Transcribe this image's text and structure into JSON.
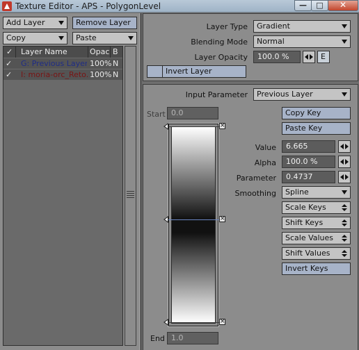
{
  "window": {
    "title": "Texture Editor - APS - PolygonLevel",
    "controls": {
      "minimize": "—",
      "maximize": "□",
      "close": "✕"
    }
  },
  "toolbar": {
    "add_layer": "Add Layer",
    "remove_layer": "Remove Layer",
    "copy": "Copy",
    "paste": "Paste"
  },
  "layer_list": {
    "columns": {
      "check": "✓",
      "name": "Layer Name",
      "opacity": "Opac",
      "blend": "B"
    },
    "rows": [
      {
        "check": "✓",
        "name": "G: Previous Layer",
        "opacity": "100%",
        "blend": "N",
        "name_color": "#1f2c86"
      },
      {
        "check": "✓",
        "name": "I: moria-orc_Reto...",
        "opacity": "100%",
        "blend": "N",
        "name_color": "#7a1414"
      }
    ]
  },
  "layer_props": {
    "layer_type_label": "Layer Type",
    "layer_type_value": "Gradient",
    "blending_mode_label": "Blending Mode",
    "blending_mode_value": "Normal",
    "opacity_label": "Layer Opacity",
    "opacity_value": "100.0 %",
    "envelope_button": "E",
    "invert_layer": "Invert Layer"
  },
  "gradient": {
    "input_parameter_label": "Input Parameter",
    "input_parameter_value": "Previous Layer",
    "start_label": "Start",
    "start_value": "0.0",
    "end_label": "End",
    "end_value": "1.0",
    "copy_key": "Copy Key",
    "paste_key": "Paste Key",
    "value_label": "Value",
    "value": "6.665",
    "alpha_label": "Alpha",
    "alpha": "100.0 %",
    "parameter_label": "Parameter",
    "parameter": "0.4737",
    "smoothing_label": "Smoothing",
    "smoothing_value": "Spline",
    "scale_keys": "Scale Keys",
    "shift_keys": "Shift Keys",
    "scale_values": "Scale Values",
    "shift_values": "Shift Values",
    "invert_keys": "Invert Keys",
    "key_positions": [
      0.0,
      0.4737,
      1.0
    ],
    "selected_key": 1
  },
  "colors": {
    "panel": "#8c8c8c",
    "accent_button": "#a7b3c8",
    "field": "#5c5c5c"
  }
}
